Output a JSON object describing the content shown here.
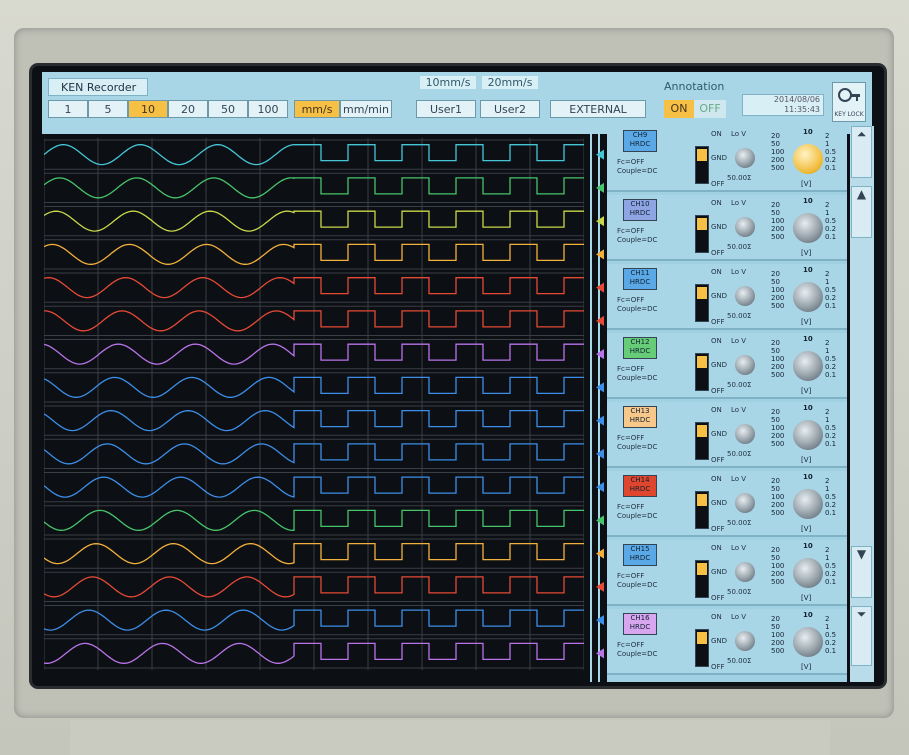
{
  "topbar": {
    "title": "KEN Recorder",
    "speed_buttons": [
      "1",
      "5",
      "10",
      "20",
      "50",
      "100"
    ],
    "speed_selected": "10",
    "unit_buttons": [
      "mm/s",
      "mm/min"
    ],
    "unit_selected": "mm/s",
    "user1_speed": "10mm/s",
    "user2_speed": "20mm/s",
    "user1_label": "User1",
    "user2_label": "User2",
    "external_label": "EXTERNAL",
    "annotation_label": "Annotation",
    "annotation_on": "ON",
    "annotation_off": "OFF",
    "date": "2014/08/06",
    "time": "11:35:43",
    "keylock_label": "KEY LOCK"
  },
  "channels": [
    {
      "name": "CH9",
      "mode": "HRDC",
      "label_color": "#5aa9e6",
      "fc": "Fc=OFF",
      "couple": "Couple=DC",
      "volt": "50.00Σ",
      "knob_yellow": true
    },
    {
      "name": "CH10",
      "mode": "HRDC",
      "label_color": "#8fa5e3",
      "fc": "Fc=OFF",
      "couple": "Couple=DC",
      "volt": "50.00Σ",
      "knob_yellow": false
    },
    {
      "name": "CH11",
      "mode": "HRDC",
      "label_color": "#5aa9e6",
      "fc": "Fc=OFF",
      "couple": "Couple=DC",
      "volt": "50.00Σ",
      "knob_yellow": false
    },
    {
      "name": "CH12",
      "mode": "HRDC",
      "label_color": "#66cc77",
      "fc": "Fc=OFF",
      "couple": "Couple=DC",
      "volt": "50.00Σ",
      "knob_yellow": false
    },
    {
      "name": "CH13",
      "mode": "HRDC",
      "label_color": "#f7c889",
      "fc": "Fc=OFF",
      "couple": "Couple=DC",
      "volt": "50.00Σ",
      "knob_yellow": false
    },
    {
      "name": "CH14",
      "mode": "HRDC",
      "label_color": "#e0452e",
      "fc": "Fc=OFF",
      "couple": "Couple=DC",
      "volt": "50.00Σ",
      "knob_yellow": false
    },
    {
      "name": "CH15",
      "mode": "HRDC",
      "label_color": "#5aa9e6",
      "fc": "Fc=OFF",
      "couple": "Couple=DC",
      "volt": "50.00Σ",
      "knob_yellow": false
    },
    {
      "name": "CH16",
      "mode": "HRDC",
      "label_color": "#d7a6ef",
      "fc": "Fc=OFF",
      "couple": "Couple=DC",
      "volt": "50.00Σ",
      "knob_yellow": false
    }
  ],
  "switch_labels": {
    "on": "ON",
    "gnd": "GND",
    "off": "OFF",
    "lov": "Lo V"
  },
  "range_scale": {
    "left": [
      "20",
      "50",
      "100",
      "200",
      "500"
    ],
    "top": "10",
    "right": [
      "2",
      "1",
      "0.5",
      "0.2",
      "0.1"
    ],
    "unit": "[V]"
  },
  "traces": [
    "#45c6d6",
    "#47c46b",
    "#c9d84a",
    "#f2b13c",
    "#e54a35",
    "#e54a35",
    "#b874e8",
    "#3d8ee8",
    "#3d8ee8",
    "#3d8ee8",
    "#3d8ee8",
    "#47c46b",
    "#f2b13c",
    "#e54a35",
    "#3d8ee8",
    "#b874e8"
  ]
}
